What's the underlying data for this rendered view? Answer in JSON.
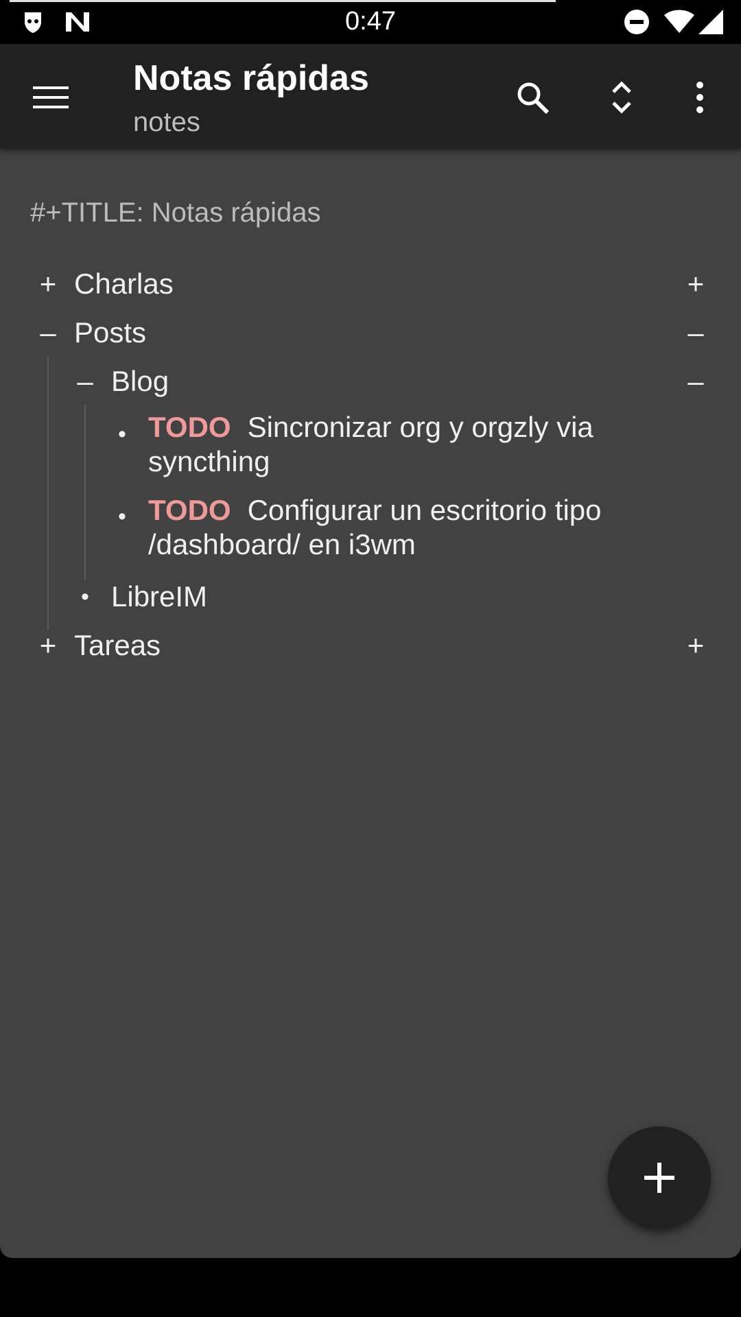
{
  "status_bar": {
    "time": "0:47",
    "left_icons": [
      "security-shield-icon",
      "n-notification-icon"
    ],
    "right_icons": [
      "do-not-disturb-icon",
      "wifi-icon",
      "cell-signal-icon"
    ]
  },
  "app_bar": {
    "title": "Notas rápidas",
    "subtitle": "notes",
    "actions": [
      "menu-icon",
      "search-icon",
      "expand-collapse-icon",
      "more-vert-icon"
    ]
  },
  "document": {
    "file_title": "#+TITLE: Notas rápidas",
    "outline": {
      "charlas": {
        "toggle": "+",
        "label": "Charlas",
        "right": "+"
      },
      "posts": {
        "toggle": "–",
        "label": "Posts",
        "right": "–"
      },
      "blog": {
        "toggle": "–",
        "label": "Blog",
        "right": "–"
      },
      "note1": {
        "bullet": "•",
        "keyword": "TODO",
        "text": "Sincronizar org y orgzly via syncthing"
      },
      "note2": {
        "bullet": "•",
        "keyword": "TODO",
        "text": "Configurar un escritorio tipo /dashboard/ en i3wm"
      },
      "libreim": {
        "bullet": "•",
        "label": "LibreIM"
      },
      "tareas": {
        "toggle": "+",
        "label": "Tareas",
        "right": "+"
      }
    }
  },
  "fab": {
    "icon": "plus-icon"
  },
  "colors": {
    "todo": "#ef9a9a",
    "app_bar": "#212121",
    "background": "#424242"
  }
}
